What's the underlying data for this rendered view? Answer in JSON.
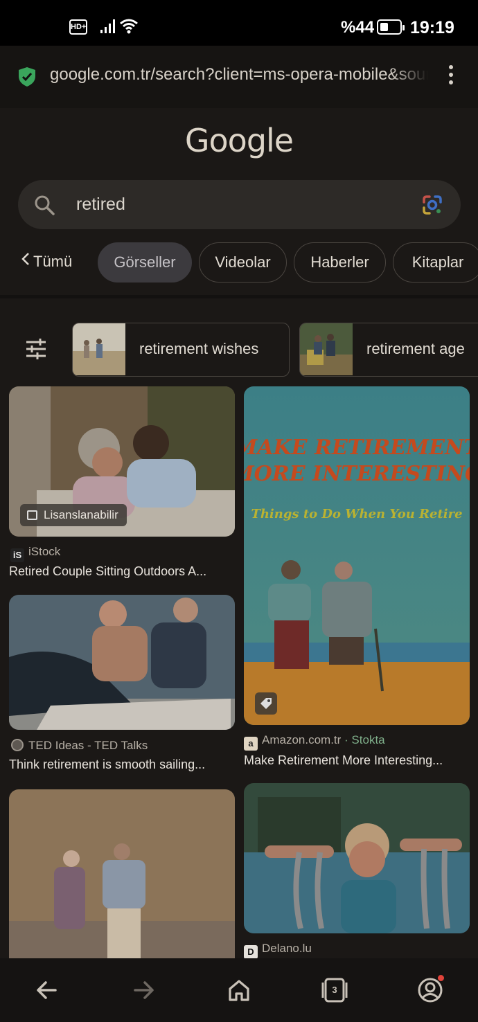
{
  "status": {
    "hd": "HD+",
    "battery_pct": "%44",
    "battery_level": 0.44,
    "time": "19:19"
  },
  "browser": {
    "url": "google.com.tr/search?client=ms-opera-mobile&source",
    "tab_count": "3"
  },
  "logo": "Google",
  "search": {
    "query": "retired"
  },
  "tabs": {
    "back": "Tümü",
    "items": [
      "Görseller",
      "Videolar",
      "Haberler",
      "Kitaplar"
    ]
  },
  "filters": [
    "retirement wishes",
    "retirement age"
  ],
  "results": [
    {
      "badge": "Lisanslanabilir",
      "source": "iStock",
      "title": "Retired Couple Sitting Outdoors A..."
    },
    {
      "source": "TED Ideas - TED Talks",
      "title": "Think retirement is smooth sailing..."
    },
    {
      "overlay_line1": "MAKE RETIREMENT",
      "overlay_line2": "MORE INTERESTING",
      "overlay_sub": "Things to Do When You Retire",
      "source": "Amazon.com.tr",
      "source_extra": "· Stokta",
      "title": "Make Retirement More Interesting..."
    },
    {
      "source": "Delano.lu"
    }
  ],
  "colors": {
    "background": "#1b1816",
    "active_tab": "#3c3a3e",
    "stock_green": "#7fae8a"
  }
}
